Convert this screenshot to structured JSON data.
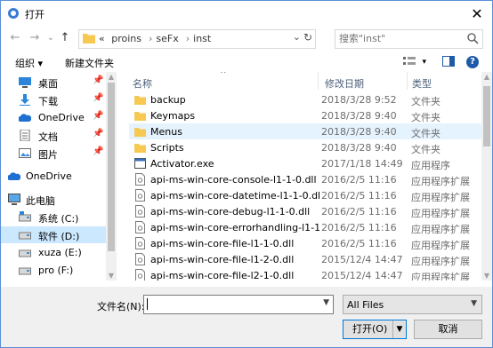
{
  "window": {
    "title": "打开",
    "close_glyph": "✕"
  },
  "nav": {
    "back_glyph": "←",
    "forward_glyph": "→",
    "recent_glyph": "⌄",
    "up_glyph": "↑",
    "breadcrumb_prefix": "«",
    "breadcrumb": [
      "proins",
      "seFx",
      "inst"
    ],
    "breadcrumb_sep": "›",
    "dropdown_glyph": "⌄",
    "refresh_glyph": "↻",
    "search_placeholder": "搜索\"inst\""
  },
  "toolbar": {
    "organize": "组织 ▾",
    "new_folder": "新建文件夹",
    "view_glyph": "▾",
    "help_glyph": "?"
  },
  "sidebar": {
    "items": [
      {
        "label": "桌面",
        "icon": "desktop-icon",
        "pinned": true,
        "pin_glyph": "📌"
      },
      {
        "label": "下载",
        "icon": "download-icon",
        "pinned": true,
        "pin_glyph": "📌"
      },
      {
        "label": "OneDrive",
        "icon": "onedrive-icon",
        "pinned": true,
        "pin_glyph": "📌"
      },
      {
        "label": "文档",
        "icon": "documents-icon",
        "pinned": true,
        "pin_glyph": "📌"
      },
      {
        "label": "图片",
        "icon": "pictures-icon",
        "pinned": true,
        "pin_glyph": "📌"
      },
      {
        "label": "OneDrive",
        "icon": "onedrive-icon",
        "pinned": false
      },
      {
        "label": "此电脑",
        "icon": "computer-icon",
        "pinned": false
      },
      {
        "label": "系统 (C:)",
        "icon": "drive-icon",
        "pinned": false
      },
      {
        "label": "软件 (D:)",
        "icon": "drive-icon",
        "pinned": false,
        "selected": true
      },
      {
        "label": "xuza (E:)",
        "icon": "drive-icon",
        "pinned": false
      },
      {
        "label": "pro (F:)",
        "icon": "drive-icon",
        "pinned": false
      }
    ]
  },
  "columns": {
    "name": "名称",
    "date": "修改日期",
    "type": "类型",
    "sort_glyph": "^"
  },
  "files": [
    {
      "name": "backup",
      "date": "2018/3/28 9:52",
      "type": "文件夹",
      "kind": "folder"
    },
    {
      "name": "Keymaps",
      "date": "2018/3/28 9:40",
      "type": "文件夹",
      "kind": "folder"
    },
    {
      "name": "Menus",
      "date": "2018/3/28 9:40",
      "type": "文件夹",
      "kind": "folder",
      "selected": true
    },
    {
      "name": "Scripts",
      "date": "2018/3/28 9:40",
      "type": "文件夹",
      "kind": "folder"
    },
    {
      "name": "Activator.exe",
      "date": "2017/1/18 14:49",
      "type": "应用程序",
      "kind": "exe"
    },
    {
      "name": "api-ms-win-core-console-l1-1-0.dll",
      "date": "2016/2/5 11:16",
      "type": "应用程序扩展",
      "kind": "dll"
    },
    {
      "name": "api-ms-win-core-datetime-l1-1-0.dll",
      "date": "2016/2/5 11:16",
      "type": "应用程序扩展",
      "kind": "dll"
    },
    {
      "name": "api-ms-win-core-debug-l1-1-0.dll",
      "date": "2016/2/5 11:16",
      "type": "应用程序扩展",
      "kind": "dll"
    },
    {
      "name": "api-ms-win-core-errorhandling-l1-1-...",
      "date": "2016/2/5 11:16",
      "type": "应用程序扩展",
      "kind": "dll"
    },
    {
      "name": "api-ms-win-core-file-l1-1-0.dll",
      "date": "2016/2/5 11:16",
      "type": "应用程序扩展",
      "kind": "dll"
    },
    {
      "name": "api-ms-win-core-file-l1-2-0.dll",
      "date": "2015/12/4 14:47",
      "type": "应用程序扩展",
      "kind": "dll"
    },
    {
      "name": "api-ms-win-core-file-l2-1-0.dll",
      "date": "2015/12/4 14:47",
      "type": "应用程序扩展",
      "kind": "dll"
    }
  ],
  "bottom": {
    "filename_label": "文件名(N):",
    "filename_value": "",
    "filter": "All Files",
    "dropdown_glyph": "▼",
    "open": "打开(O)",
    "cancel": "取消"
  },
  "colors": {
    "accent": "#0078d7",
    "folder": "#f7c852",
    "selection": "#cce8ff"
  }
}
